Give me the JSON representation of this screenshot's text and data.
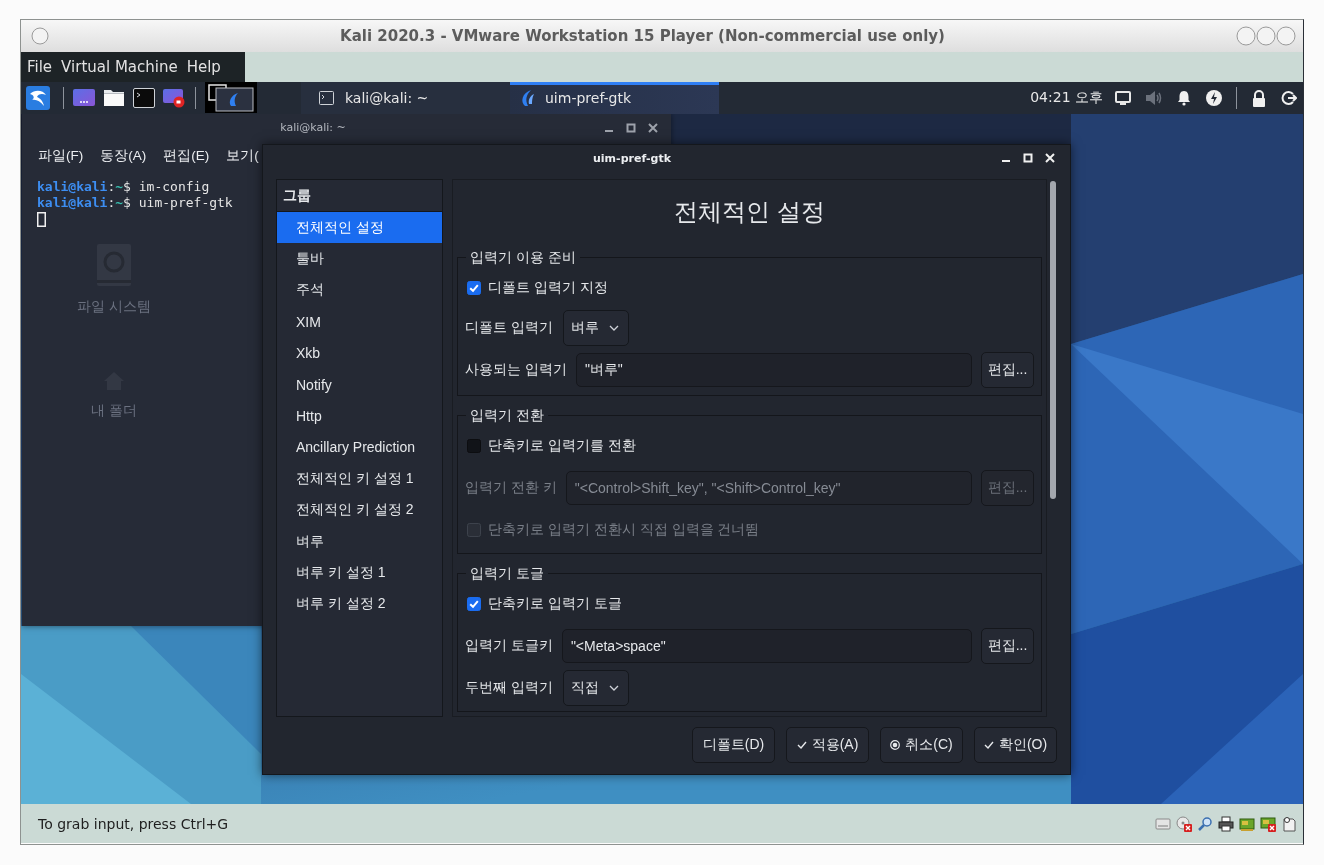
{
  "window": {
    "title": "Kali 2020.3 - VMware Workstation 15 Player (Non-commercial use only)"
  },
  "menu": [
    "File",
    "Virtual Machine",
    "Help"
  ],
  "taskbar": {
    "tasks": [
      {
        "label": "kali@kali: ~",
        "kind": "terminal",
        "selected": false
      },
      {
        "label": "uim-pref-gtk",
        "kind": "app",
        "selected": true
      }
    ],
    "clock": "04:21 오후"
  },
  "desktop_icons": [
    {
      "label": "파일 시스템",
      "kind": "drive"
    },
    {
      "label": "내 폴더",
      "kind": "home"
    }
  ],
  "terminal": {
    "title": "kali@kali: ~",
    "menu": [
      "파일(F)",
      "동장(A)",
      "편집(E)",
      "보기("
    ],
    "lines": [
      [
        {
          "kind": "user",
          "text": "kali@kali"
        },
        {
          "kind": "plain",
          "text": ":"
        },
        {
          "kind": "path",
          "text": "~"
        },
        {
          "kind": "plain",
          "text": "$ im-config"
        }
      ],
      [
        {
          "kind": "user",
          "text": "kali@kali"
        },
        {
          "kind": "plain",
          "text": ":"
        },
        {
          "kind": "path",
          "text": "~"
        },
        {
          "kind": "plain",
          "text": "$ uim-pref-gtk"
        }
      ]
    ]
  },
  "dialog": {
    "title": "uim-pref-gtk",
    "groups": {
      "header": "그룹",
      "items": [
        {
          "label": "전체적인 설정",
          "selected": true
        },
        {
          "label": "툴바",
          "selected": false
        },
        {
          "label": "주석",
          "selected": false
        },
        {
          "label": "XIM",
          "selected": false
        },
        {
          "label": "Xkb",
          "selected": false
        },
        {
          "label": "Notify",
          "selected": false
        },
        {
          "label": "Http",
          "selected": false
        },
        {
          "label": "Ancillary Prediction",
          "selected": false
        },
        {
          "label": "전체적인 키 설정 1",
          "selected": false
        },
        {
          "label": "전체적인 키 설정 2",
          "selected": false
        },
        {
          "label": "벼루",
          "selected": false
        },
        {
          "label": "벼루 키 설정 1",
          "selected": false
        },
        {
          "label": "벼루 키 설정 2",
          "selected": false
        }
      ]
    },
    "page": {
      "title": "전체적인 설정",
      "frames": [
        {
          "title": "입력기 이용 준비",
          "rows": [
            {
              "kind": "checkbox",
              "label": "디폴트 입력기 지정",
              "checked": true,
              "disabled": false
            },
            {
              "kind": "dropdown",
              "label": "디폴트 입력기",
              "value": "벼루",
              "disabled": false
            },
            {
              "kind": "field",
              "label": "사용되는 입력기",
              "value": "\"벼루\"",
              "button": "편집...",
              "disabled": false
            }
          ]
        },
        {
          "title": "입력기 전환",
          "rows": [
            {
              "kind": "checkbox",
              "label": "단축키로 입력기를 전환",
              "checked": false,
              "disabled": false
            },
            {
              "kind": "field",
              "label": "입력기 전환 키",
              "value": "\"<Control>Shift_key\", \"<Shift>Control_key\"",
              "button": "편집...",
              "disabled": true
            },
            {
              "kind": "checkbox",
              "label": "단축키로 입력기 전환시 직접 입력을 건너뜀",
              "checked": false,
              "disabled": true
            }
          ]
        },
        {
          "title": "입력기 토글",
          "rows": [
            {
              "kind": "checkbox",
              "label": "단축키로 입력기 토글",
              "checked": true,
              "disabled": false
            },
            {
              "kind": "field",
              "label": "입력기 토글키",
              "value": "\"<Meta>space\"",
              "button": "편집...",
              "disabled": false
            },
            {
              "kind": "dropdown",
              "label": "두번째 입력기",
              "value": "직접",
              "disabled": false
            }
          ]
        }
      ]
    },
    "buttons": [
      {
        "label": "디폴트(D)",
        "kind": "plain"
      },
      {
        "label": "적용(A)",
        "kind": "apply"
      },
      {
        "label": "취소(C)",
        "kind": "cancel"
      },
      {
        "label": "확인(O)",
        "kind": "ok"
      }
    ]
  },
  "status_bar": {
    "text": "To grab input, press Ctrl+G"
  }
}
